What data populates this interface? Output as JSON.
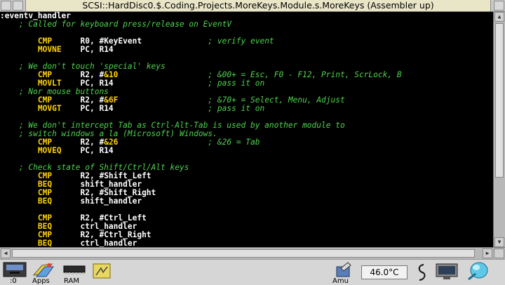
{
  "window": {
    "title": "SCSI::HardDisc0.$.Coding.Projects.MoreKeys.Module.s.MoreKeys (Assembler up)"
  },
  "code_lines": [
    {
      "label": ":eventv_handler",
      "op": "",
      "args": "",
      "num": "",
      "tail": "",
      "comment": ""
    },
    {
      "label": "",
      "op": "",
      "args": "",
      "num": "",
      "tail": "",
      "comment": "    ; Called for keyboard press/release on EventV"
    },
    {
      "label": "",
      "op": "",
      "args": "",
      "num": "",
      "tail": "",
      "comment": ""
    },
    {
      "label": "",
      "op": "CMP",
      "args": "R0, #KeyEvent",
      "num": "",
      "tail": "; verify event",
      "comment": ""
    },
    {
      "label": "",
      "op": "MOVNE",
      "args": "PC, R14",
      "num": "",
      "tail": "",
      "comment": ""
    },
    {
      "label": "",
      "op": "",
      "args": "",
      "num": "",
      "tail": "",
      "comment": ""
    },
    {
      "label": "",
      "op": "",
      "args": "",
      "num": "",
      "tail": "",
      "comment": "    ; We don't touch 'special' keys"
    },
    {
      "label": "",
      "op": "CMP",
      "args": "R2, #",
      "num": "&10",
      "tail": "; &00+ = Esc, F0 - F12, Print, ScrLock, B",
      "comment": ""
    },
    {
      "label": "",
      "op": "MOVLT",
      "args": "PC, R14",
      "num": "",
      "tail": "; pass it on",
      "comment": ""
    },
    {
      "label": "",
      "op": "",
      "args": "",
      "num": "",
      "tail": "",
      "comment": "    ; Nor mouse buttons"
    },
    {
      "label": "",
      "op": "CMP",
      "args": "R2, #",
      "num": "&6F",
      "tail": "; &70+ = Select, Menu, Adjust",
      "comment": ""
    },
    {
      "label": "",
      "op": "MOVGT",
      "args": "PC, R14",
      "num": "",
      "tail": "; pass it on",
      "comment": ""
    },
    {
      "label": "",
      "op": "",
      "args": "",
      "num": "",
      "tail": "",
      "comment": ""
    },
    {
      "label": "",
      "op": "",
      "args": "",
      "num": "",
      "tail": "",
      "comment": "    ; We don't intercept Tab as Ctrl-Alt-Tab is used by another module to"
    },
    {
      "label": "",
      "op": "",
      "args": "",
      "num": "",
      "tail": "",
      "comment": "    ; switch windows a la (Microsoft) Windows."
    },
    {
      "label": "",
      "op": "CMP",
      "args": "R2, #",
      "num": "&26",
      "tail": "; &26 = Tab",
      "comment": ""
    },
    {
      "label": "",
      "op": "MOVEQ",
      "args": "PC, R14",
      "num": "",
      "tail": "",
      "comment": ""
    },
    {
      "label": "",
      "op": "",
      "args": "",
      "num": "",
      "tail": "",
      "comment": ""
    },
    {
      "label": "",
      "op": "",
      "args": "",
      "num": "",
      "tail": "",
      "comment": "    ; Check state of Shift/Ctrl/Alt keys"
    },
    {
      "label": "",
      "op": "CMP",
      "args": "R2, #Shift_Left",
      "num": "",
      "tail": "",
      "comment": ""
    },
    {
      "label": "",
      "op": "BEQ",
      "args": "shift_handler",
      "num": "",
      "tail": "",
      "comment": ""
    },
    {
      "label": "",
      "op": "CMP",
      "args": "R2, #Shift_Right",
      "num": "",
      "tail": "",
      "comment": ""
    },
    {
      "label": "",
      "op": "BEQ",
      "args": "shift_handler",
      "num": "",
      "tail": "",
      "comment": ""
    },
    {
      "label": "",
      "op": "",
      "args": "",
      "num": "",
      "tail": "",
      "comment": ""
    },
    {
      "label": "",
      "op": "CMP",
      "args": "R2, #Ctrl_Left",
      "num": "",
      "tail": "",
      "comment": ""
    },
    {
      "label": "",
      "op": "BEQ",
      "args": "ctrl_handler",
      "num": "",
      "tail": "",
      "comment": ""
    },
    {
      "label": "",
      "op": "CMP",
      "args": "R2, #Ctrl_Right",
      "num": "",
      "tail": "",
      "comment": ""
    },
    {
      "label": "",
      "op": "BEQ",
      "args": "ctrl_handler",
      "num": "",
      "tail": "",
      "comment": ""
    }
  ],
  "iconbar": {
    "drive_label": ":0",
    "apps_label": "Apps",
    "ram_label": "RAM",
    "amu_label": "Amu",
    "temperature": "46.0°C",
    "icons": [
      "floppy-drive-icon",
      "apps-icon",
      "ram-disc-icon",
      "filer-icon",
      "amu-icon",
      "clock-icon",
      "display-icon",
      "task-manager-icon"
    ]
  },
  "colors": {
    "comment": "#4ed24e",
    "opcode": "#ffd400",
    "text": "#ffffff",
    "background": "#000000",
    "title_bg": "#e9e6c8"
  }
}
